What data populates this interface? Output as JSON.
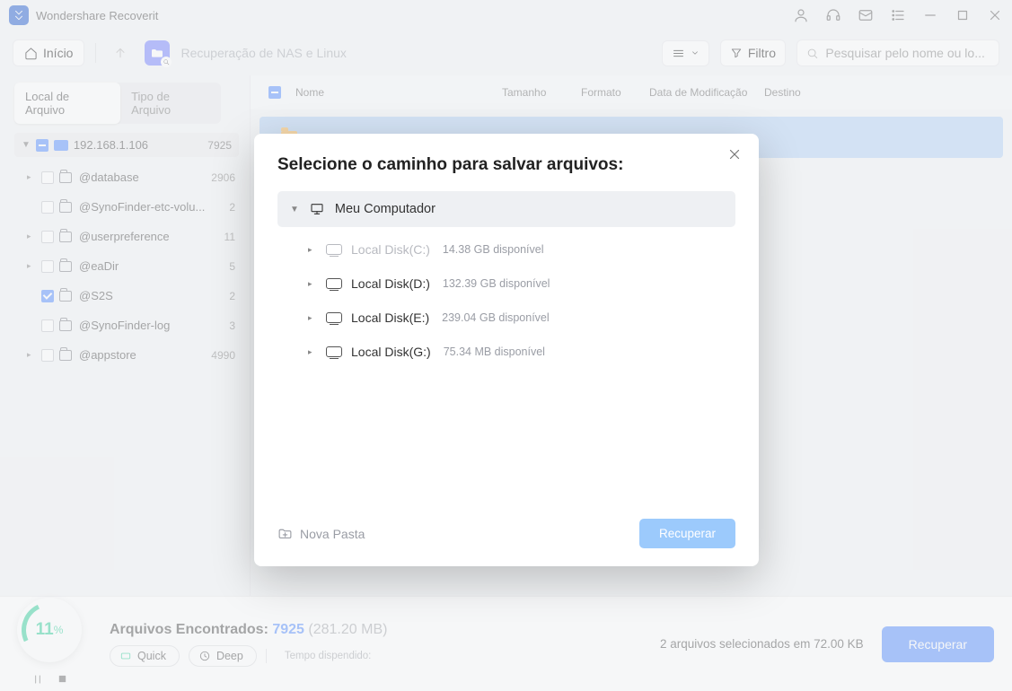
{
  "app": {
    "title": "Wondershare Recoverit"
  },
  "toolbar": {
    "home": "Início",
    "breadcrumb": "Recuperação de NAS e Linux",
    "filter": "Filtro",
    "search_placeholder": "Pesquisar pelo nome ou lo..."
  },
  "sidebar": {
    "tabs": {
      "location": "Local de Arquivo",
      "type": "Tipo de Arquivo"
    },
    "root": {
      "label": "192.168.1.106",
      "count": "7925"
    },
    "items": [
      {
        "label": "@database",
        "count": "2906",
        "checked": false,
        "caret": true
      },
      {
        "label": "@SynoFinder-etc-volu...",
        "count": "2",
        "checked": false,
        "caret": false
      },
      {
        "label": "@userpreference",
        "count": "11",
        "checked": false,
        "caret": true
      },
      {
        "label": "@eaDir",
        "count": "5",
        "checked": false,
        "caret": true
      },
      {
        "label": "@S2S",
        "count": "2",
        "checked": true,
        "caret": false
      },
      {
        "label": "@SynoFinder-log",
        "count": "3",
        "checked": false,
        "caret": false
      },
      {
        "label": "@appstore",
        "count": "4990",
        "checked": false,
        "caret": true
      }
    ]
  },
  "table": {
    "headers": {
      "name": "Nome",
      "size": "Tamanho",
      "format": "Formato",
      "modified": "Data de Modificação",
      "dest": "Destino"
    }
  },
  "footer": {
    "progress_value": "11",
    "progress_pct": "%",
    "found_label": "Arquivos Encontrados:",
    "found_count": "7925",
    "found_size": "(281.20 MB)",
    "mode_quick": "Quick",
    "mode_deep": "Deep",
    "time_label": "Tempo dispendido:",
    "selected_text": "2 arquivos selecionados em 72.00 KB",
    "recover": "Recuperar"
  },
  "modal": {
    "title": "Selecione o caminho para salvar arquivos:",
    "root": "Meu Computador",
    "disks": [
      {
        "label": "Local Disk(C:)",
        "avail": "14.38 GB disponível",
        "disabled": true
      },
      {
        "label": "Local Disk(D:)",
        "avail": "132.39 GB disponível",
        "disabled": false
      },
      {
        "label": "Local Disk(E:)",
        "avail": "239.04 GB disponível",
        "disabled": false
      },
      {
        "label": "Local Disk(G:)",
        "avail": "75.34 MB disponível",
        "disabled": false
      }
    ],
    "new_folder": "Nova Pasta",
    "recover": "Recuperar"
  }
}
